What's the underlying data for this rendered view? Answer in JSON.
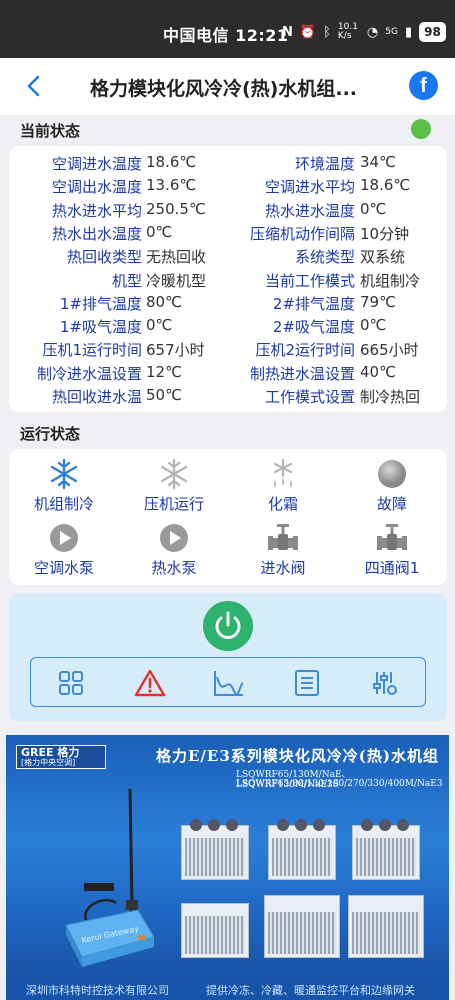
{
  "status_bar": {
    "carrier": "中国电信",
    "time": "12:21",
    "net_speed": "10.1 K/s",
    "network": "5G",
    "battery": "98"
  },
  "header": {
    "title": "格力模块化风冷冷(热)水机组...",
    "back_icon": "chevron-left-icon",
    "facebook_icon": "f"
  },
  "current_status": {
    "section_title": "当前状态",
    "indicator_color": "#5cbf46",
    "rows": [
      {
        "label1": "空调进水温度",
        "value1": "18.6℃",
        "label2": "环境温度",
        "value2": "34℃"
      },
      {
        "label1": "空调出水温度",
        "value1": "13.6℃",
        "label2": "空调进水平均",
        "value2": "18.6℃"
      },
      {
        "label1": "热水进水平均",
        "value1": "250.5℃",
        "label2": "热水进水温度",
        "value2": "0℃"
      },
      {
        "label1": "热水出水温度",
        "value1": "0℃",
        "label2": "压缩机动作间隔",
        "value2": "10分钟"
      },
      {
        "label1": "热回收类型",
        "value1": "无热回收",
        "label2": "系统类型",
        "value2": "双系统"
      },
      {
        "label1": "机型",
        "value1": "冷暖机型",
        "label2": "当前工作模式",
        "value2": "机组制冷"
      },
      {
        "label1": "1#排气温度",
        "value1": "80℃",
        "label2": "2#排气温度",
        "value2": "79℃"
      },
      {
        "label1": "1#吸气温度",
        "value1": "0℃",
        "label2": "2#吸气温度",
        "value2": "0℃"
      },
      {
        "label1": "压机1运行时间",
        "value1": "657小时",
        "label2": "压机2运行时间",
        "value2": "665小时"
      },
      {
        "label1": "制冷进水温设置",
        "value1": "12℃",
        "label2": "制热进水温设置",
        "value2": "40℃"
      },
      {
        "label1": "热回收进水温",
        "value1": "50℃",
        "label2": "工作模式设置",
        "value2": "制冷热回"
      }
    ]
  },
  "run_status": {
    "section_title": "运行状态",
    "items": [
      {
        "label": "机组制冷",
        "icon": "snowflake-active-icon"
      },
      {
        "label": "压机运行",
        "icon": "snowflake-inactive-icon"
      },
      {
        "label": "化霜",
        "icon": "defrost-icon"
      },
      {
        "label": "故障",
        "icon": "fault-indicator-icon"
      },
      {
        "label": "空调水泵",
        "icon": "pump-icon"
      },
      {
        "label": "热水泵",
        "icon": "pump-icon"
      },
      {
        "label": "进水阀",
        "icon": "valve-icon"
      },
      {
        "label": "四通阀1",
        "icon": "valve-icon"
      }
    ]
  },
  "controls": {
    "power_color": "#2db36b",
    "tools": [
      "grid-icon",
      "alarm-warning-icon",
      "chart-icon",
      "list-icon",
      "settings-sliders-icon"
    ]
  },
  "banner": {
    "brand": "GREE 格力",
    "brand_sub": "[格力中央空调]",
    "title": "格力E/E3系列模块化风冷冷(热)水机组",
    "models": [
      "LSQWRF65/130M/NaE、LSQWRF130M/NaE3S",
      "LSQWRF65/80/130/160/270/330/400M/NaE3"
    ],
    "gateway_brand": "Kerui",
    "gateway_model": "Gateway",
    "company": "深圳市科特时控技术有限公司",
    "slogan": "提供冷冻、冷藏、暖通监控平台和边缘网关"
  }
}
